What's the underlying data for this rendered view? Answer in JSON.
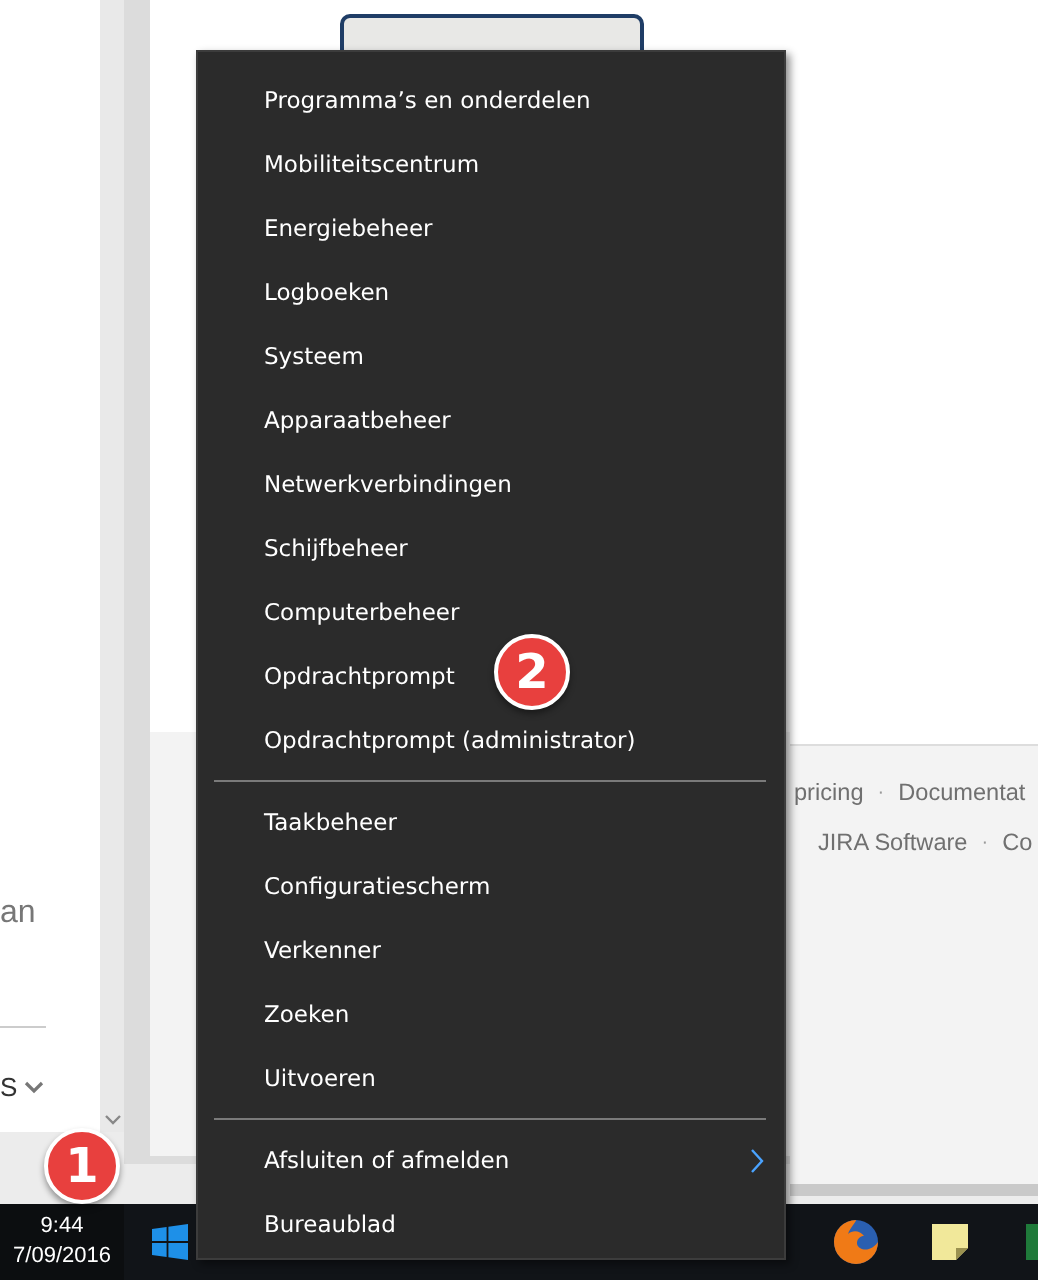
{
  "left_page": {
    "text": "an",
    "dropdown_label": "S"
  },
  "footer_rows": [
    [
      "pricing",
      "·",
      "Documentat"
    ],
    [
      "JIRA Software",
      "·",
      "Co"
    ]
  ],
  "context_menu": {
    "groups": [
      {
        "items": [
          {
            "label": "Programma’s en onderdelen",
            "has_submenu": false
          },
          {
            "label": "Mobiliteitscentrum",
            "has_submenu": false
          },
          {
            "label": "Energiebeheer",
            "has_submenu": false
          },
          {
            "label": "Logboeken",
            "has_submenu": false
          },
          {
            "label": "Systeem",
            "has_submenu": false
          },
          {
            "label": "Apparaatbeheer",
            "has_submenu": false
          },
          {
            "label": "Netwerkverbindingen",
            "has_submenu": false
          },
          {
            "label": "Schijfbeheer",
            "has_submenu": false
          },
          {
            "label": "Computerbeheer",
            "has_submenu": false
          },
          {
            "label": "Opdrachtprompt",
            "has_submenu": false
          },
          {
            "label": "Opdrachtprompt (administrator)",
            "has_submenu": false
          }
        ]
      },
      {
        "items": [
          {
            "label": "Taakbeheer",
            "has_submenu": false
          },
          {
            "label": "Configuratiescherm",
            "has_submenu": false
          },
          {
            "label": "Verkenner",
            "has_submenu": false
          },
          {
            "label": "Zoeken",
            "has_submenu": false
          },
          {
            "label": "Uitvoeren",
            "has_submenu": false
          }
        ]
      },
      {
        "items": [
          {
            "label": "Afsluiten of afmelden",
            "has_submenu": true
          },
          {
            "label": "Bureaublad",
            "has_submenu": false
          }
        ]
      }
    ]
  },
  "taskbar": {
    "time": "9:44",
    "date": "7/09/2016"
  },
  "callouts": [
    "1",
    "2"
  ]
}
